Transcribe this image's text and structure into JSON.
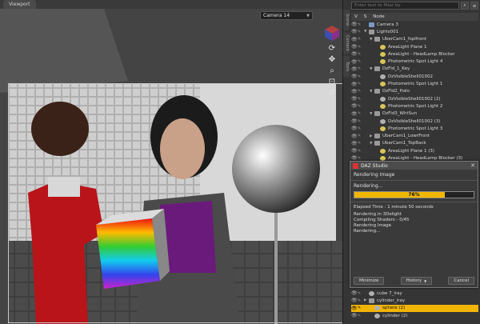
{
  "viewport": {
    "tab_label": "Viewport",
    "camera_value": "Camera 14",
    "nav_icons": [
      "select-icon",
      "orbit-icon",
      "pan-icon",
      "zoom-icon",
      "frame-icon",
      "reset-icon"
    ]
  },
  "panel": {
    "search_placeholder": "Enter text to filter by",
    "side_tabs": [
      "Scene",
      "Content",
      "Tools"
    ],
    "header": {
      "visible_col": "V",
      "select_col": "S",
      "node_col": "Node"
    },
    "tree": [
      {
        "label": "Camera 3",
        "type": "cam",
        "indent": 0
      },
      {
        "label": "Lights001",
        "type": "group",
        "indent": 0,
        "expanded": true
      },
      {
        "label": "UberCam1_fsplfront",
        "type": "group",
        "indent": 1,
        "expanded": true
      },
      {
        "label": "AreaLight Plane 1",
        "type": "light",
        "indent": 2
      },
      {
        "label": "AreaLight - HeadLamp Blocker",
        "type": "light",
        "indent": 2
      },
      {
        "label": "Photometric Spot Light 4",
        "type": "light",
        "indent": 2
      },
      {
        "label": "DzFld_1_Key",
        "type": "group",
        "indent": 1,
        "expanded": true
      },
      {
        "label": "DzVisibleShell01002",
        "type": "mesh",
        "indent": 2
      },
      {
        "label": "Photometric Spot Light 1",
        "type": "light",
        "indent": 2
      },
      {
        "label": "DzFld2_Halo",
        "type": "group",
        "indent": 1,
        "expanded": true
      },
      {
        "label": "DzVisibleShell01002 (2)",
        "type": "mesh",
        "indent": 2
      },
      {
        "label": "Photometric Spot Light 2",
        "type": "light",
        "indent": 2
      },
      {
        "label": "DzFld3_WhtSun",
        "type": "group",
        "indent": 1,
        "expanded": true
      },
      {
        "label": "DzVisibleShell01002 (3)",
        "type": "mesh",
        "indent": 2
      },
      {
        "label": "Photometric Spot Light 3",
        "type": "light",
        "indent": 2
      },
      {
        "label": "UberCam1_LowrFront",
        "type": "group",
        "indent": 1
      },
      {
        "label": "UberCam1_TopBack",
        "type": "group",
        "indent": 1,
        "expanded": true
      },
      {
        "label": "AreaLight Plane 1 (3)",
        "type": "light",
        "indent": 2
      },
      {
        "label": "AreaLight - HeadLamp Blocker (3)",
        "type": "light",
        "indent": 2
      }
    ],
    "tree_bottom": [
      {
        "label": "cube 7_iray",
        "type": "mesh",
        "indent": 0,
        "selected": false
      },
      {
        "label": "cylinder_iray",
        "type": "group",
        "indent": 0,
        "selected": false
      },
      {
        "label": "sphere (2)",
        "type": "mesh",
        "indent": 1,
        "selected": true
      },
      {
        "label": "cylinder (2)",
        "type": "mesh",
        "indent": 1,
        "selected": false
      }
    ]
  },
  "render_dialog": {
    "title": "DAZ Studio",
    "heading": "Rendering Image",
    "status_label": "Rendering...",
    "progress_percent": 76,
    "progress_text": "76%",
    "elapsed": "Elapsed Time : 1 minute 50 seconds",
    "log": [
      "Rendering in 3Delight",
      "Compiling Shaders - 0/45",
      "Rendering Image",
      "Rendering..."
    ],
    "buttons": {
      "minimize": "Minimize",
      "history": "History",
      "cancel": "Cancel"
    }
  },
  "colors": {
    "accent": "#f1b400",
    "progress": "#f2b600",
    "panel_bg": "#353535"
  }
}
